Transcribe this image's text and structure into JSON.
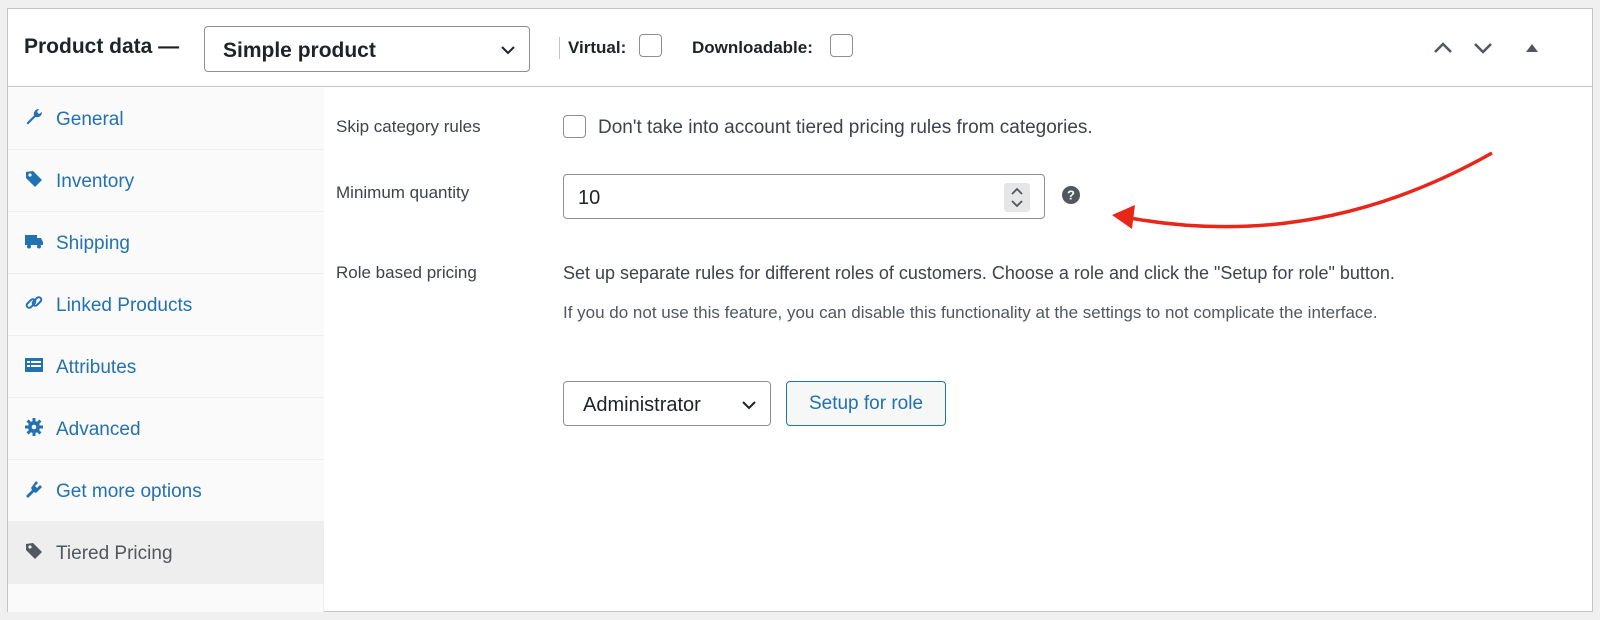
{
  "header": {
    "title": "Product data —",
    "product_type": "Simple product",
    "virtual_label": "Virtual:",
    "downloadable_label": "Downloadable:"
  },
  "sidebar": {
    "items": [
      {
        "label": "General",
        "icon": "wrench-icon"
      },
      {
        "label": "Inventory",
        "icon": "tag-icon"
      },
      {
        "label": "Shipping",
        "icon": "truck-icon"
      },
      {
        "label": "Linked Products",
        "icon": "link-icon"
      },
      {
        "label": "Attributes",
        "icon": "list-icon"
      },
      {
        "label": "Advanced",
        "icon": "gear-icon"
      },
      {
        "label": "Get more options",
        "icon": "plug-icon"
      },
      {
        "label": "Tiered Pricing",
        "icon": "price-tag-icon",
        "active": true
      }
    ]
  },
  "main": {
    "skip_label": "Skip category rules",
    "skip_desc": "Don't take into account tiered pricing rules from categories.",
    "min_qty_label": "Minimum quantity",
    "min_qty_value": "10",
    "role_label": "Role based pricing",
    "role_desc": "Set up separate rules for different roles of customers. Choose a role and click the \"Setup for role\" button.",
    "role_note": "If you do not use this feature, you can disable this functionality at the settings to not complicate the interface.",
    "role_select": "Administrator",
    "setup_button": "Setup for role"
  },
  "colors": {
    "accent": "#2271b1",
    "annotation_arrow": "#e8271b"
  }
}
